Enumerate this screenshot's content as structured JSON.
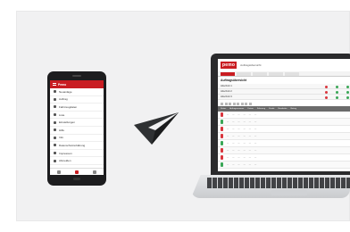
{
  "phone": {
    "app_title": "Pemo",
    "menu_items": [
      {
        "label": "Neuanlage",
        "icon": "add-icon"
      },
      {
        "label": "Auftrag",
        "icon": "edit-icon"
      },
      {
        "label": "Fahrzeugdaten",
        "icon": "car-icon"
      },
      {
        "label": "Liste",
        "icon": "list-icon"
      },
      {
        "label": "Einstellungen",
        "icon": "gear-icon"
      },
      {
        "label": "Hilfe",
        "icon": "help-icon"
      },
      {
        "label": "Info",
        "icon": "info-icon"
      },
      {
        "label": "Datenschutzerklärung",
        "icon": "lock-icon"
      },
      {
        "label": "Impressum",
        "icon": "info-icon"
      },
      {
        "label": "Abmelden",
        "icon": "logout-icon"
      }
    ]
  },
  "laptop": {
    "logo": "pemo",
    "title": "Auftragsübersicht",
    "section": "Auftragsübersicht",
    "summary_rows": [
      "Abschnitt 1",
      "Abschnitt 2",
      "Abschnitt 3"
    ],
    "columns": [
      "Status",
      "Auftragsnummer",
      "Datum",
      "Fahrzeug",
      "Kunde",
      "Bearbeiter",
      "Betrag"
    ],
    "rows": [
      [
        "—",
        "—",
        "—",
        "—",
        "—",
        "—"
      ],
      [
        "—",
        "—",
        "—",
        "—",
        "—",
        "—"
      ],
      [
        "—",
        "—",
        "—",
        "—",
        "—",
        "—"
      ],
      [
        "—",
        "—",
        "—",
        "—",
        "—",
        "—"
      ],
      [
        "—",
        "—",
        "—",
        "—",
        "—",
        "—"
      ],
      [
        "—",
        "—",
        "—",
        "—",
        "—",
        "—"
      ],
      [
        "—",
        "—",
        "—",
        "—",
        "—",
        "—"
      ],
      [
        "—",
        "—",
        "—",
        "—",
        "—",
        "—"
      ]
    ],
    "footer": ""
  },
  "colors": {
    "brand_red": "#c91d22",
    "status_green": "#3aa757",
    "status_red": "#d9363e"
  }
}
